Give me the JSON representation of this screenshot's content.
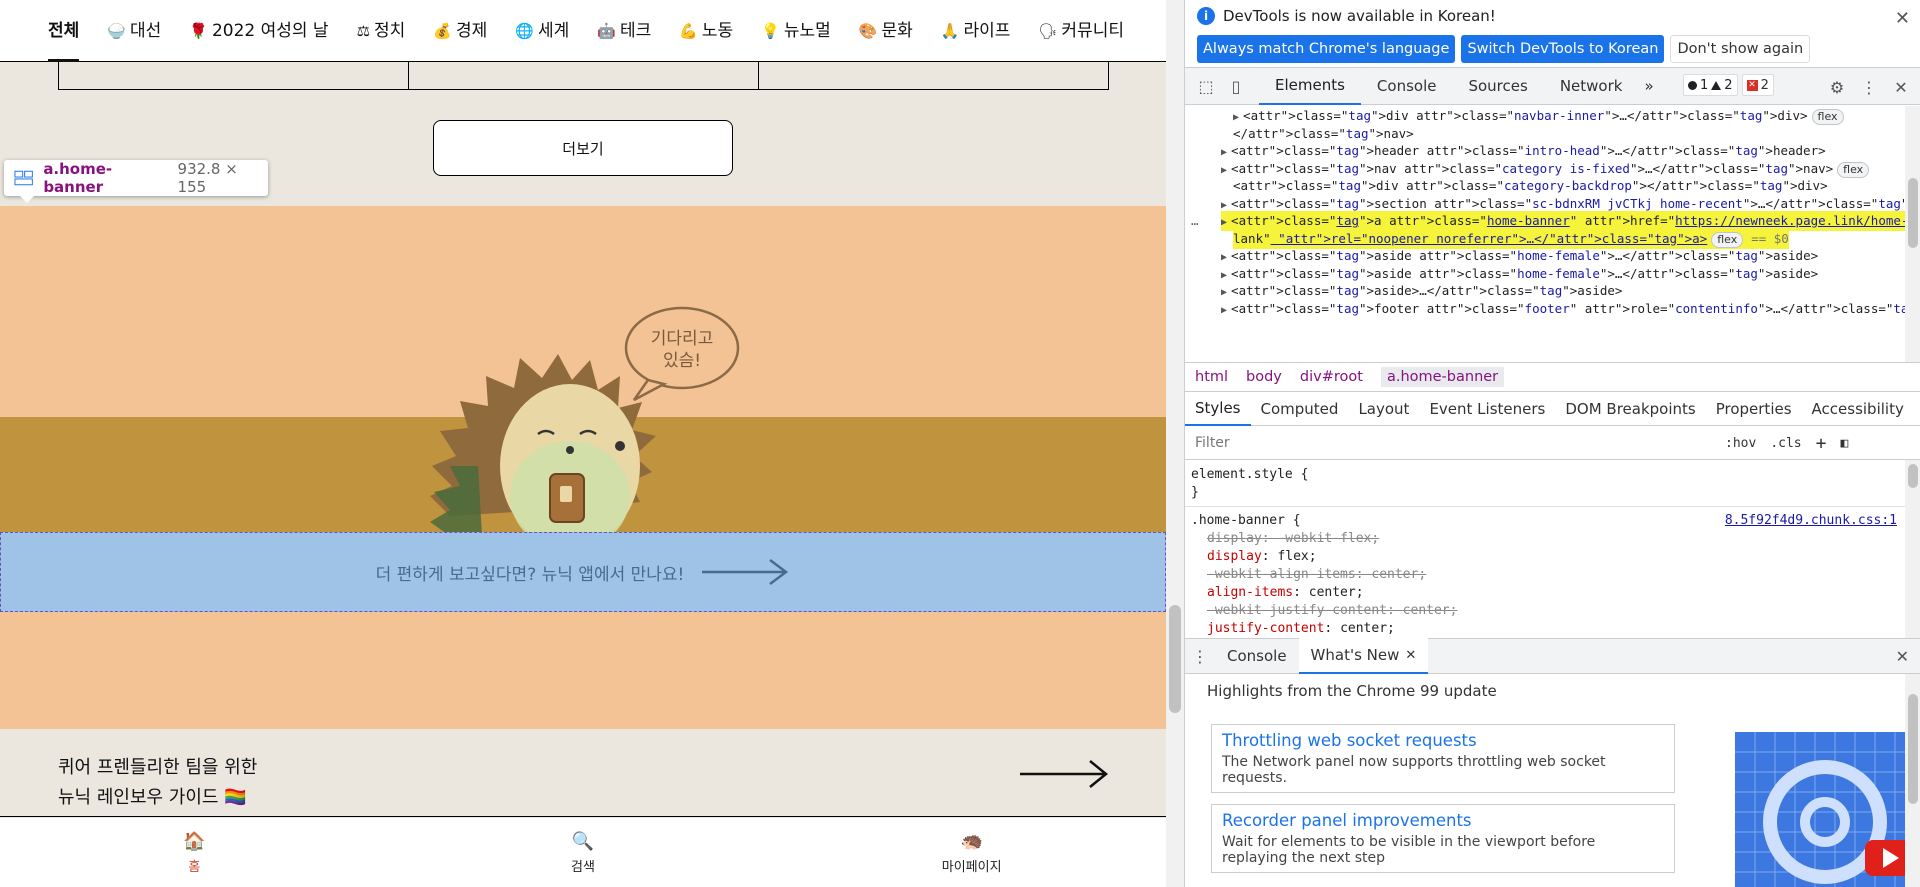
{
  "page": {
    "categories": [
      {
        "icon": "",
        "label": "전체",
        "active": true
      },
      {
        "icon": "🍚",
        "label": "대선"
      },
      {
        "icon": "🌹",
        "label": "2022 여성의 날"
      },
      {
        "icon": "⚖",
        "label": "정치"
      },
      {
        "icon": "💰",
        "label": "경제"
      },
      {
        "icon": "🌐",
        "label": "세계"
      },
      {
        "icon": "🤖",
        "label": "테크"
      },
      {
        "icon": "💪",
        "label": "노동"
      },
      {
        "icon": "💡",
        "label": "뉴노멀"
      },
      {
        "icon": "🎨",
        "label": "문화"
      },
      {
        "icon": "🙏",
        "label": "라이프"
      },
      {
        "icon": "🗣",
        "label": "커뮤니티"
      }
    ],
    "more_button": "더보기",
    "tooltip": {
      "selector": "a.home-banner",
      "size": "932.8 × 155"
    },
    "banner": {
      "speech": "기다리고\n있슴!",
      "cta": "더 편하게 보고싶다면? 뉴닉 앱에서 만나요!"
    },
    "rainbow": {
      "line1": "퀴어 프렌들리한 팀을 위한",
      "line2": "뉴닉 레인보우 가이드 🏳️‍🌈"
    },
    "bottom_nav": [
      {
        "icon": "🏠",
        "label": "홈",
        "active": true
      },
      {
        "icon": "🔍",
        "label": "검색"
      },
      {
        "icon": "🦔",
        "label": "마이페이지"
      }
    ],
    "colors": {
      "banner_bg": "#f3c396",
      "banner_band": "#c0933f",
      "cta_bg": "#9fc2e7",
      "page_bg": "#ebe7df"
    }
  },
  "devtools": {
    "infobar": {
      "message": "DevTools is now available in Korean!",
      "btn_match": "Always match Chrome's language",
      "btn_switch": "Switch DevTools to Korean",
      "btn_dismiss": "Don't show again"
    },
    "tabs": [
      "Elements",
      "Console",
      "Sources",
      "Network"
    ],
    "active_tab": "Elements",
    "more_tabs": "»",
    "counts": {
      "info": "1",
      "warn": "2",
      "err": "2"
    },
    "dom": [
      {
        "indent": 4,
        "arrow": "▶",
        "html": "<div class=\"navbar-inner\">…</div>",
        "pill": "flex"
      },
      {
        "indent": 3,
        "arrow": "",
        "html": "</nav>"
      },
      {
        "indent": 3,
        "arrow": "▶",
        "html": "<header class=\"intro-head\">…</header>"
      },
      {
        "indent": 3,
        "arrow": "▶",
        "html": "<nav class=\"category is-fixed\">…</nav>",
        "pill": "flex"
      },
      {
        "indent": 3,
        "arrow": "",
        "html": "<div class=\"category-backdrop\"></div>"
      },
      {
        "indent": 3,
        "arrow": "▶",
        "html": "<section class=\"sc-bdnxRM jvCTkj home-recent\">…</section>"
      },
      {
        "indent": 3,
        "arrow": "▶",
        "html": "<a class=\"home-banner\" href=\"https://newneek.page.link/home-banner\" target=\"_b",
        "selected": true
      },
      {
        "indent": 3,
        "arrow": "",
        "html": "lank\" rel=\"noopener noreferrer\">…</a>",
        "pill": "flex",
        "suffix": "== $0",
        "selected": true
      },
      {
        "indent": 3,
        "arrow": "▶",
        "html": "<aside class=\"home-female\">…</aside>"
      },
      {
        "indent": 3,
        "arrow": "▶",
        "html": "<aside class=\"home-female\">…</aside>"
      },
      {
        "indent": 3,
        "arrow": "▶",
        "html": "<aside>…</aside>"
      },
      {
        "indent": 3,
        "arrow": "▶",
        "html": "<footer class=\"footer\" role=\"contentinfo\">…</footer>",
        "pill": "flex"
      }
    ],
    "breadcrumbs": [
      "html",
      "body",
      "div#root",
      "a.home-banner"
    ],
    "sub_tabs": [
      "Styles",
      "Computed",
      "Layout",
      "Event Listeners",
      "DOM Breakpoints",
      "Properties",
      "Accessibility"
    ],
    "filter": {
      "placeholder": "Filter",
      "hov": ":hov",
      "cls": ".cls",
      "plus": "+"
    },
    "styles": {
      "element_style": "element.style {",
      "close": "}",
      "rule_selector": ".home-banner {",
      "source": "8.5f92f4d9.chunk.css:1",
      "props": [
        {
          "name": "display",
          "value": "-webkit-flex;",
          "struck": true
        },
        {
          "name": "display",
          "value": "flex;",
          "struck": false
        },
        {
          "name": "-webkit-align-items",
          "value": "center;",
          "struck": true
        },
        {
          "name": "align-items",
          "value": "center;",
          "struck": false
        },
        {
          "name": "-webkit-justify-content",
          "value": "center;",
          "struck": true
        },
        {
          "name": "justify-content",
          "value": "center;",
          "struck": false
        }
      ]
    },
    "drawer": {
      "tabs": [
        "Console",
        "What's New"
      ],
      "active": "What's New",
      "heading": "Highlights from the Chrome 99 update",
      "cards": [
        {
          "title": "Throttling web socket requests",
          "desc": "The Network panel now supports throttling web socket requests."
        },
        {
          "title": "Recorder panel improvements",
          "desc": "Wait for elements to be visible in the viewport before replaying the next step"
        }
      ]
    }
  }
}
